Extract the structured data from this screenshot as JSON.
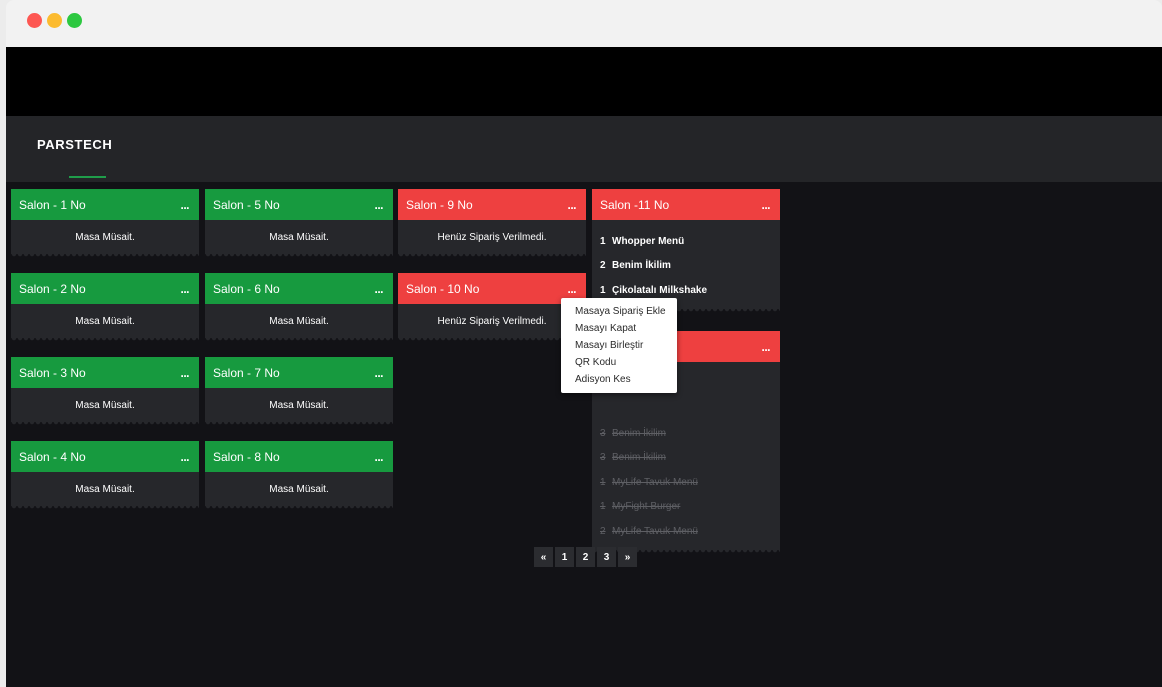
{
  "brand": {
    "name": "PARSTECH"
  },
  "available_tables": [
    {
      "title": "Salon - 1 No",
      "status": "Masa Müsait."
    },
    {
      "title": "Salon - 2 No",
      "status": "Masa Müsait."
    },
    {
      "title": "Salon - 3 No",
      "status": "Masa Müsait."
    },
    {
      "title": "Salon - 4 No",
      "status": "Masa Müsait."
    },
    {
      "title": "Salon - 5 No",
      "status": "Masa Müsait."
    },
    {
      "title": "Salon - 6 No",
      "status": "Masa Müsait."
    },
    {
      "title": "Salon - 7 No",
      "status": "Masa Müsait."
    },
    {
      "title": "Salon - 8 No",
      "status": "Masa Müsait."
    }
  ],
  "pending_tables": [
    {
      "title": "Salon - 9 No",
      "status": "Henüz Sipariş Verilmedi."
    },
    {
      "title": "Salon - 10 No",
      "status": "Henüz Sipariş Verilmedi."
    }
  ],
  "table_11": {
    "title": "Salon -11 No",
    "items": [
      {
        "qty": "1",
        "name": "Whopper Menü"
      },
      {
        "qty": "2",
        "name": "Benim İkilim"
      },
      {
        "qty": "1",
        "name": "Çikolatalı Milkshake"
      }
    ]
  },
  "table_12": {
    "items": [
      {
        "qty": "3",
        "name": "Benim İkilim"
      },
      {
        "qty": "3",
        "name": "Benim İkilim"
      },
      {
        "qty": "1",
        "name": "MyLife Tavuk Menü"
      },
      {
        "qty": "1",
        "name": "MyFight Burger"
      },
      {
        "qty": "2",
        "name": "MyLife Tavuk Menü"
      }
    ]
  },
  "more_label": "...",
  "context_menu": {
    "items": [
      "Masaya Sipariş Ekle",
      "Masayı Kapat",
      "Masayı Birleştir",
      "QR Kodu",
      "Adisyon Kes"
    ]
  },
  "pagination": {
    "prev": "«",
    "pages": [
      "1",
      "2",
      "3"
    ],
    "next": "»"
  },
  "colors": {
    "available": "#179a3f",
    "occupied": "#ee4040",
    "background": "#121216",
    "card": "#26272b"
  }
}
